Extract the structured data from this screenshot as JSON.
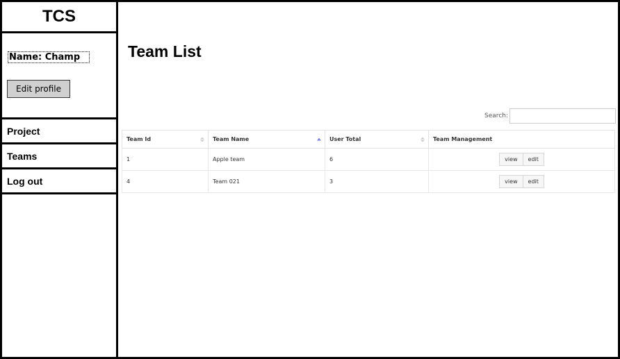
{
  "sidebar": {
    "brand": "TCS",
    "profile": {
      "name_label": "Name: Champ",
      "edit_button": "Edit profile"
    },
    "nav": [
      {
        "label": "Project"
      },
      {
        "label": "Teams"
      },
      {
        "label": "Log out"
      }
    ]
  },
  "main": {
    "title": "Team List",
    "search": {
      "label": "Search:",
      "value": "",
      "placeholder": ""
    },
    "table": {
      "columns": [
        "Team Id",
        "Team Name",
        "User Total",
        "Team Management"
      ],
      "sorted_column": "Team Name",
      "sort_direction": "ascending",
      "rows": [
        {
          "id": "1",
          "name": "Apple team",
          "users": "6",
          "actions": [
            "view",
            "edit"
          ]
        },
        {
          "id": "4",
          "name": "Team 021",
          "users": "3",
          "actions": [
            "view",
            "edit"
          ]
        }
      ]
    }
  },
  "colors": {
    "border": "#000000",
    "button_bg": "#d0d0d0",
    "sort_active": "#7b7fd4"
  }
}
